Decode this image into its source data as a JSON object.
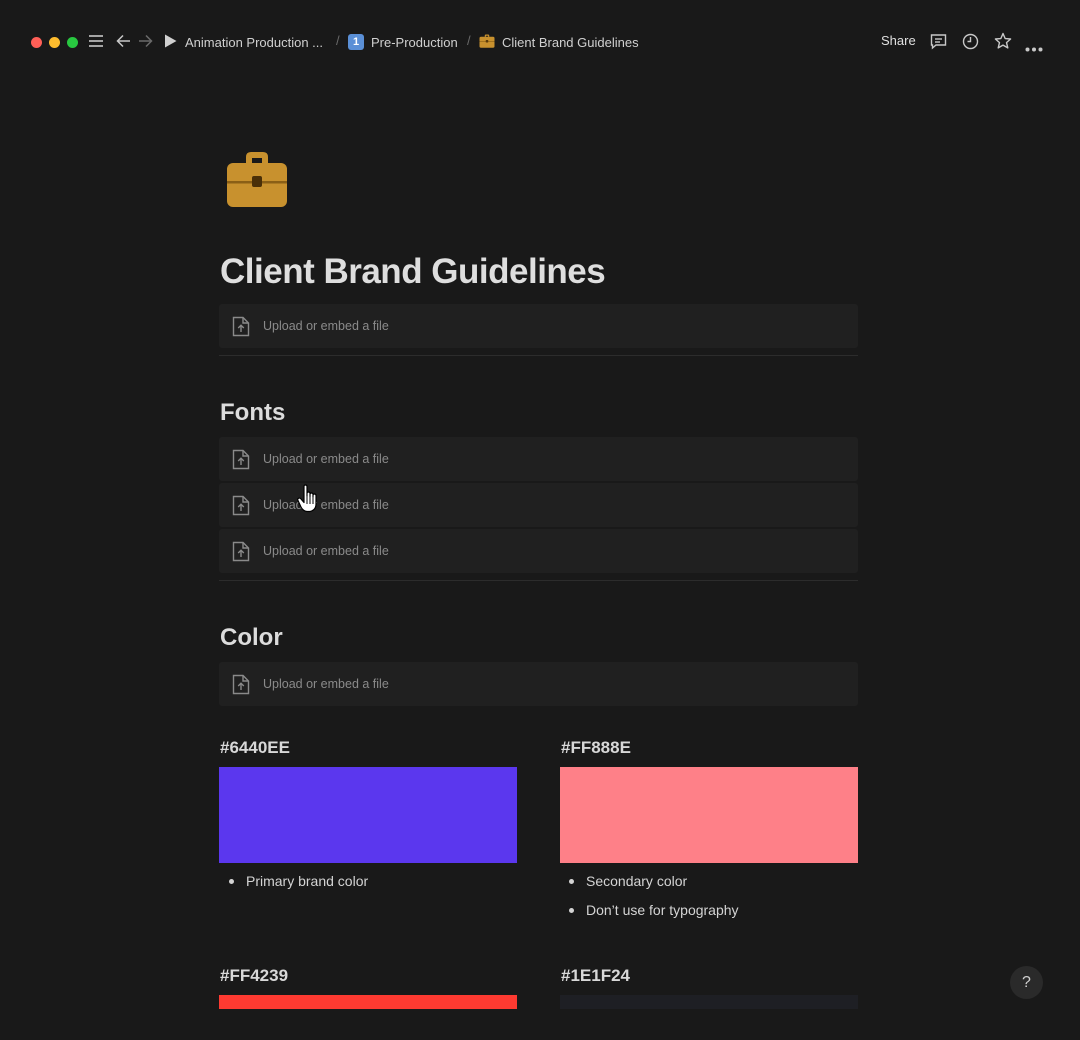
{
  "window": {
    "traffic_lights": [
      "#ff5f57",
      "#febc2e",
      "#28c840"
    ]
  },
  "breadcrumb": {
    "items": [
      {
        "icon": "play-icon",
        "label": "Animation Production ..."
      },
      {
        "icon": "keycap-1-emoji",
        "label": "Pre-Production"
      },
      {
        "icon": "briefcase-icon",
        "label": "Client Brand Guidelines"
      }
    ],
    "separator": "/"
  },
  "toolbar": {
    "share_label": "Share",
    "icons": [
      "comment-icon",
      "clock-icon",
      "star-icon",
      "more-icon"
    ]
  },
  "page": {
    "icon": "briefcase-icon",
    "icon_color": "#c8912e",
    "title": "Client Brand Guidelines"
  },
  "upload_placeholder": "Upload or embed a file",
  "sections": {
    "fonts": {
      "heading": "Fonts"
    },
    "color": {
      "heading": "Color"
    }
  },
  "colors": [
    {
      "hex_label": "#6440EE",
      "swatch": "#5b37ee",
      "notes": [
        "Primary brand color"
      ]
    },
    {
      "hex_label": "#FF888E",
      "swatch": "#fe8088",
      "notes": [
        "Secondary color",
        "Don’t use for typography"
      ]
    },
    {
      "hex_label": "#FF4239",
      "swatch": "#fe3a31",
      "notes": []
    },
    {
      "hex_label": "#1E1F24",
      "swatch": "#1e1f24",
      "notes": []
    }
  ],
  "help": {
    "label": "?"
  }
}
